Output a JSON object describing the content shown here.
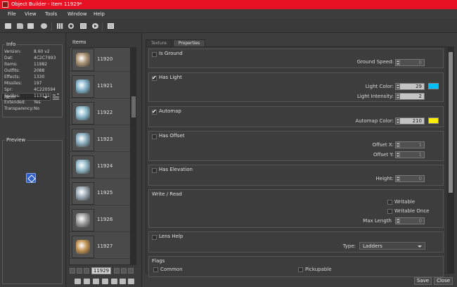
{
  "window": {
    "title": "Object Builder - Item 11929*"
  },
  "menu": [
    "File",
    "View",
    "Tools",
    "Window",
    "Help"
  ],
  "info": {
    "title": "Info",
    "rows": [
      {
        "label": "Version:",
        "value": "8.60 v2"
      },
      {
        "label": "Dat:",
        "value": "4C2C7993"
      },
      {
        "label": "Items:",
        "value": "11982"
      },
      {
        "label": "Outfits:",
        "value": "2088"
      },
      {
        "label": "Effects:",
        "value": "1330"
      },
      {
        "label": "Missiles:",
        "value": "197"
      },
      {
        "label": "Spr:",
        "value": "4C220594"
      },
      {
        "label": "Sprites:",
        "value": "113131"
      },
      {
        "label": "Extended:",
        "value": "Yes"
      },
      {
        "label": "Transparency:",
        "value": "No"
      }
    ]
  },
  "category_select": {
    "value": "Item"
  },
  "preview": {
    "title": "Preview"
  },
  "items_panel": {
    "title": "Items",
    "items": [
      {
        "id": "11920",
        "color": "#a89070"
      },
      {
        "id": "11921",
        "color": "#7fb0c8"
      },
      {
        "id": "11922",
        "color": "#8ab8cc"
      },
      {
        "id": "11923",
        "color": "#86aabc"
      },
      {
        "id": "11924",
        "color": "#8fb6c6"
      },
      {
        "id": "11925",
        "color": "#9aa8b4"
      },
      {
        "id": "11926",
        "color": "#9c9c9c"
      },
      {
        "id": "11927",
        "color": "#c09050"
      }
    ],
    "page_value": "11929"
  },
  "tabs": [
    {
      "label": "Texture",
      "active": false
    },
    {
      "label": "Properties",
      "active": true
    }
  ],
  "props": {
    "is_ground": {
      "label": "Is Ground",
      "checked": false,
      "ground_speed_label": "Ground Speed:",
      "ground_speed": "0"
    },
    "has_light": {
      "label": "Has Light",
      "checked": true,
      "color_label": "Light Color:",
      "color_value": "29",
      "color_swatch": "#00bfff",
      "intensity_label": "Light Intensity:",
      "intensity": "2"
    },
    "automap": {
      "label": "Automap",
      "checked": true,
      "color_label": "Automap Color:",
      "color_value": "210",
      "color_swatch": "#ffee00"
    },
    "has_offset": {
      "label": "Has Offset",
      "checked": false,
      "x_label": "Offset X:",
      "x": "1",
      "y_label": "Offset Y:",
      "y": "1"
    },
    "has_elevation": {
      "label": "Has Elevation",
      "checked": false,
      "height_label": "Height:",
      "height": "0"
    },
    "write_read": {
      "title": "Write / Read",
      "writable": "Writable",
      "writable_once": "Writable Once",
      "max_length_label": "Max Length",
      "max_length": "0"
    },
    "lens_help": {
      "label": "Lens Help",
      "checked": false,
      "type_label": "Type:",
      "type_value": "Ladders"
    },
    "flags": {
      "title": "Flags",
      "common": "Common",
      "pickupable": "Pickupable"
    }
  },
  "buttons": {
    "save": "Save",
    "close": "Close"
  }
}
